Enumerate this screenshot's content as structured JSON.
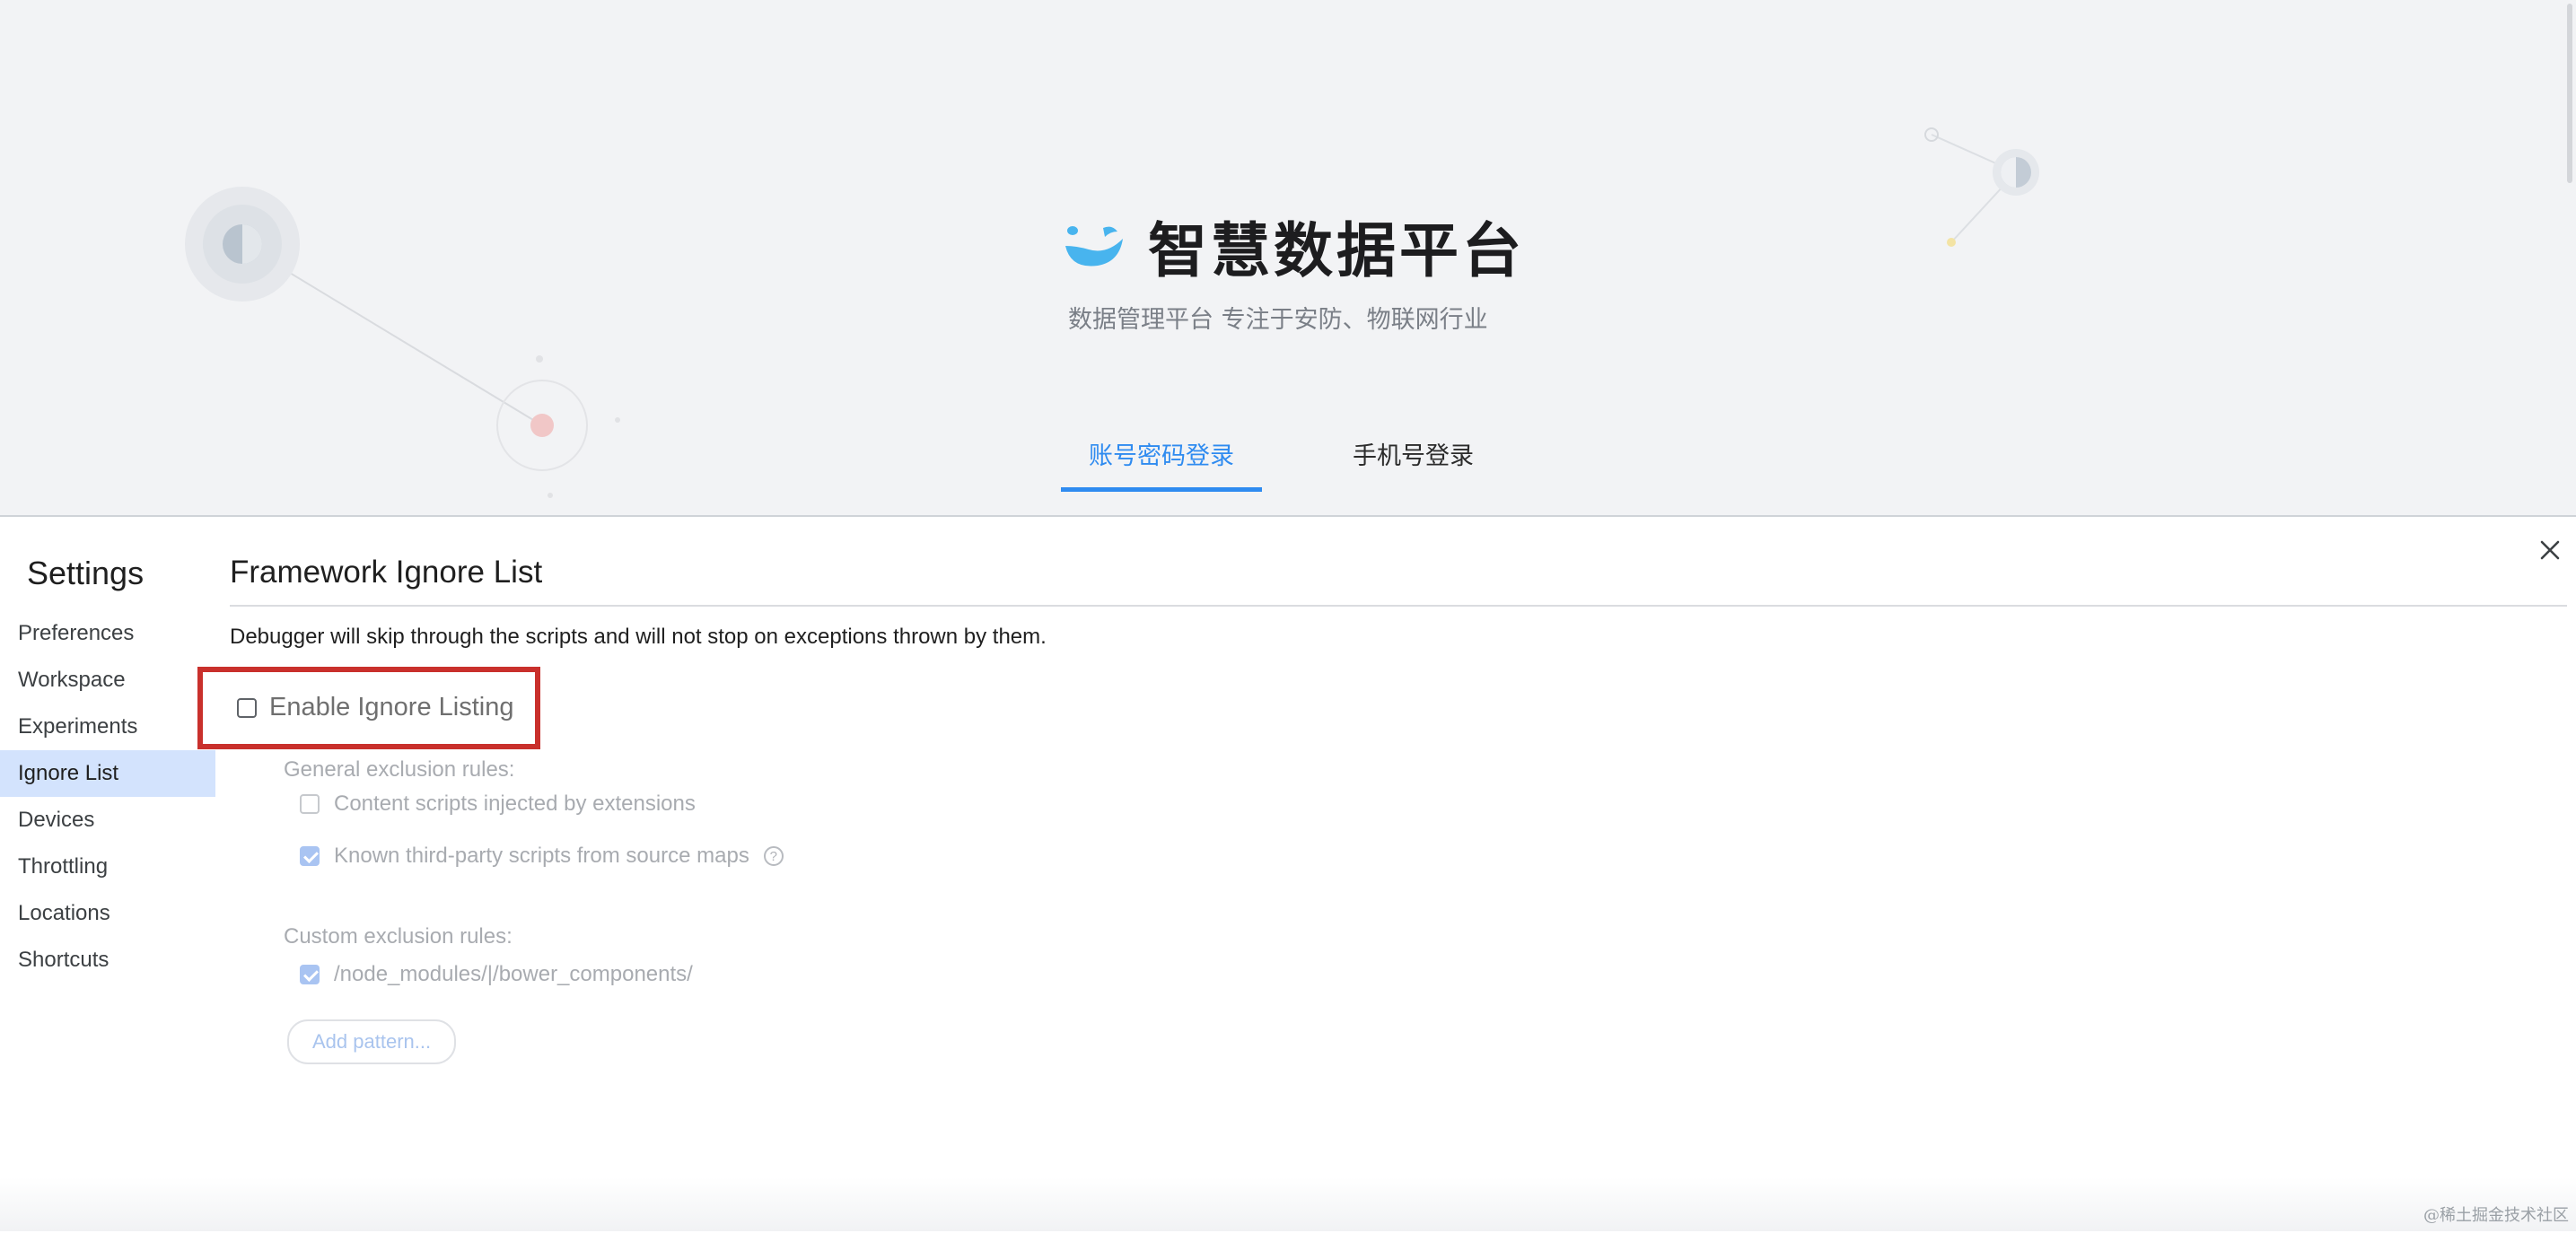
{
  "login_page": {
    "brand_title": "智慧数据平台",
    "subtitle": "数据管理平台 专注于安防、物联网行业",
    "tabs": [
      {
        "label": "账号密码登录",
        "active": true
      },
      {
        "label": "手机号登录",
        "active": false
      }
    ],
    "accent_color": "#2f8bf0"
  },
  "settings": {
    "title": "Settings",
    "nav": [
      {
        "label": "Preferences",
        "active": false
      },
      {
        "label": "Workspace",
        "active": false
      },
      {
        "label": "Experiments",
        "active": false
      },
      {
        "label": "Ignore List",
        "active": true
      },
      {
        "label": "Devices",
        "active": false
      },
      {
        "label": "Throttling",
        "active": false
      },
      {
        "label": "Locations",
        "active": false
      },
      {
        "label": "Shortcuts",
        "active": false
      }
    ],
    "close_icon": "close-icon"
  },
  "ignore_list": {
    "title": "Framework Ignore List",
    "description": "Debugger will skip through the scripts and will not stop on exceptions thrown by them.",
    "enable": {
      "label": "Enable Ignore Listing",
      "checked": false
    },
    "general_header": "General exclusion rules:",
    "general_rules": [
      {
        "label": "Content scripts injected by extensions",
        "checked": false
      },
      {
        "label": "Known third-party scripts from source maps",
        "checked": true
      }
    ],
    "custom_header": "Custom exclusion rules:",
    "custom_rules": [
      {
        "label": "/node_modules/|/bower_components/",
        "checked": true
      }
    ],
    "add_pattern_label": "Add pattern...",
    "highlight_color": "#c9302c"
  },
  "watermark": "@稀土掘金技术社区"
}
